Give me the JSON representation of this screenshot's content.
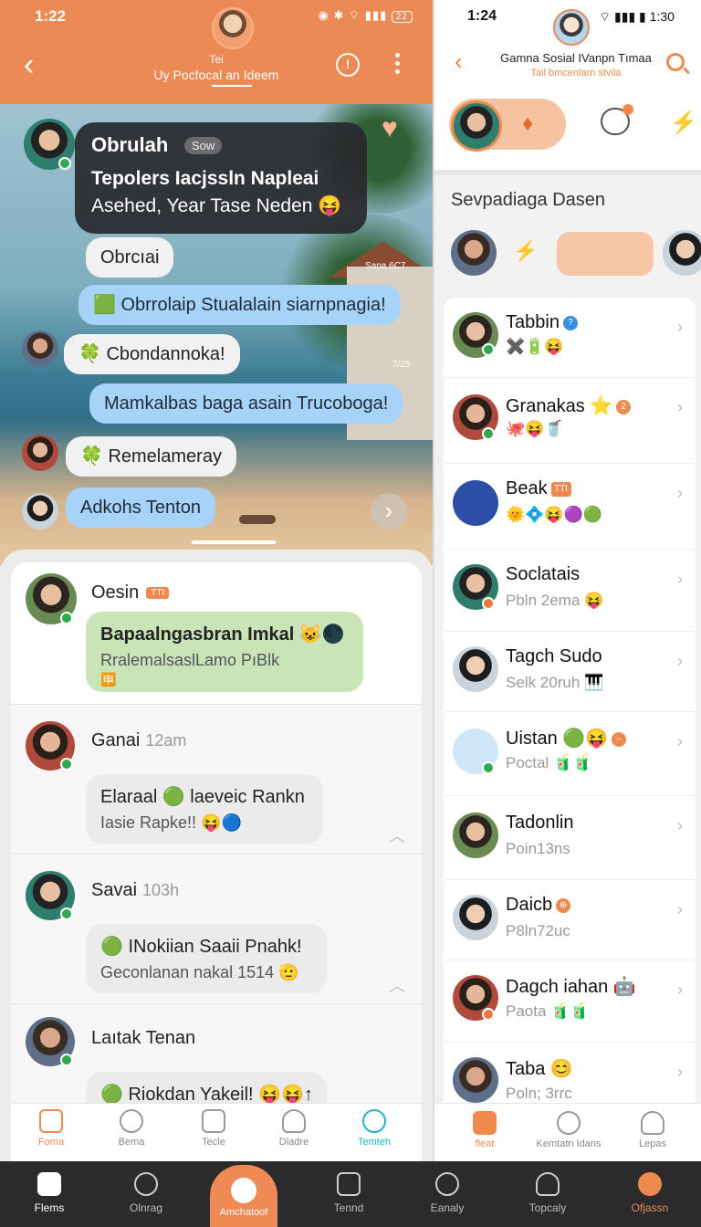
{
  "left": {
    "status": {
      "time": "1:22",
      "battery": "22"
    },
    "header": {
      "name": "Tei",
      "subtitle": "Uy Pocfocal an Ideem"
    },
    "hero": {
      "pinned": {
        "name": "Obrulah",
        "badge": "Sow",
        "line1": "Tepolers Iacjssln Napleai",
        "line2": "Asehed, Year Tase Neden 😝"
      },
      "time1": "Sana 6C7",
      "time2": "7/25",
      "messages": [
        {
          "text": "Obrcıai",
          "style": "white"
        },
        {
          "text": "🟩 Obrrolaip Stualalain siarnpnagia!",
          "style": "blue"
        },
        {
          "text": "🍀 Cbondannoka!",
          "style": "white"
        },
        {
          "text": "Mamkalbas baga asain Trucoboga!",
          "style": "blue"
        },
        {
          "text": "🍀 Remelameray",
          "style": "white"
        },
        {
          "text": "Adkohs Tenton",
          "style": "blue"
        }
      ]
    },
    "feed": [
      {
        "name": "Oesin",
        "tag": "TTI",
        "time": "",
        "line1": "Bapaalngasbran Imkal 😺🌑",
        "line2": "RralemalsaslLamo PıBlk",
        "extra": "🈸"
      },
      {
        "name": "Ganai",
        "tag": "",
        "time": "12am",
        "line1": "Elaraal 🟢 laeveic Rankn",
        "line2": "Iasie Rapke!! 😝🔵",
        "extra": ""
      },
      {
        "name": "Savai",
        "tag": "",
        "time": "103h",
        "line1": "🟢 INokiian Saaii Pnahk!",
        "line2": "Geconlanan nakal 1514 🫡",
        "extra": ""
      },
      {
        "name": "Laıtak Tenan",
        "tag": "",
        "time": "",
        "line1": "🟢 Riokdan Yakeil! 😝😝↑",
        "line2": "",
        "extra": ""
      }
    ],
    "tabs": [
      "Foma",
      "Bema",
      "Tecle",
      "Dladre",
      "Temteh"
    ]
  },
  "right": {
    "status": {
      "time": "1:24",
      "battery": "1:30"
    },
    "header": {
      "title": "Gamna Sosial IVanpn Tımaa",
      "subtitle": "Tail bmcenlarn stvila"
    },
    "section_title": "Sevpadiaga Dasen",
    "contacts": [
      {
        "name": "Tabbin",
        "chip": "?",
        "meta": "✖️🔋😝"
      },
      {
        "name": "Granakas ⭐",
        "chip": "2",
        "meta": "🐙😝🥤"
      },
      {
        "name": "Beak",
        "chip": "TTI",
        "meta": "🌞💠😝🟣🟢"
      },
      {
        "name": "Soclatais",
        "chip": "",
        "meta": "Pbln 2ema 😝"
      },
      {
        "name": "Tagch Sudo",
        "chip": "",
        "meta": "Selk 20ruh 🎹"
      },
      {
        "name": "Uistan 🟢😝",
        "chip": "–",
        "meta": "Poctal 🧃🧃"
      },
      {
        "name": "Tadonlin",
        "chip": "",
        "meta": "Poin13ns"
      },
      {
        "name": "Daicb",
        "chip": "⊕",
        "meta": "P8ln72uc"
      },
      {
        "name": "Dagch iahan 🤖",
        "chip": "",
        "meta": "Paota 🧃🧃"
      },
      {
        "name": "Taba 😊",
        "chip": "",
        "meta": "Poln; 3rrc"
      }
    ],
    "tabs": [
      "fleat",
      "Kemtatn Idans",
      "Lepas"
    ]
  },
  "bottom": {
    "tabs": [
      "Flems",
      "Olnrag",
      "Tennd",
      "Eanaly",
      "Topcaly",
      "Ofjassn"
    ],
    "center": "Amchatoof"
  },
  "colors": {
    "accent": "#ec8a55",
    "bubble_blue": "#a6d3f7",
    "online": "#2fa84f"
  }
}
